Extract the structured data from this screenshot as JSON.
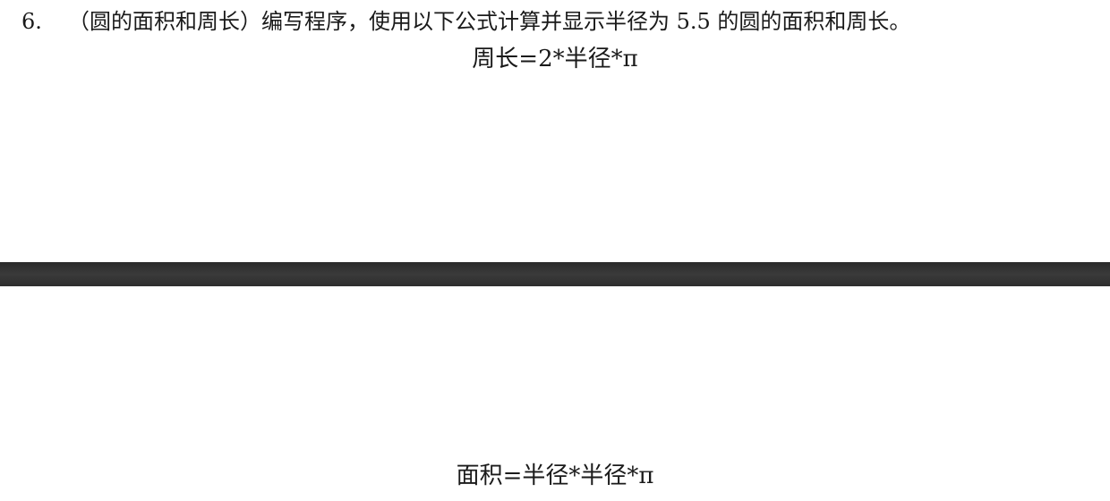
{
  "question": {
    "number": "6.",
    "text": "（圆的面积和周长）编写程序，使用以下公式计算并显示半径为 5.5 的圆的面积和周长。"
  },
  "formulas": {
    "circumference": "周长=2*半径*π",
    "area": "面积=半径*半径*π"
  }
}
